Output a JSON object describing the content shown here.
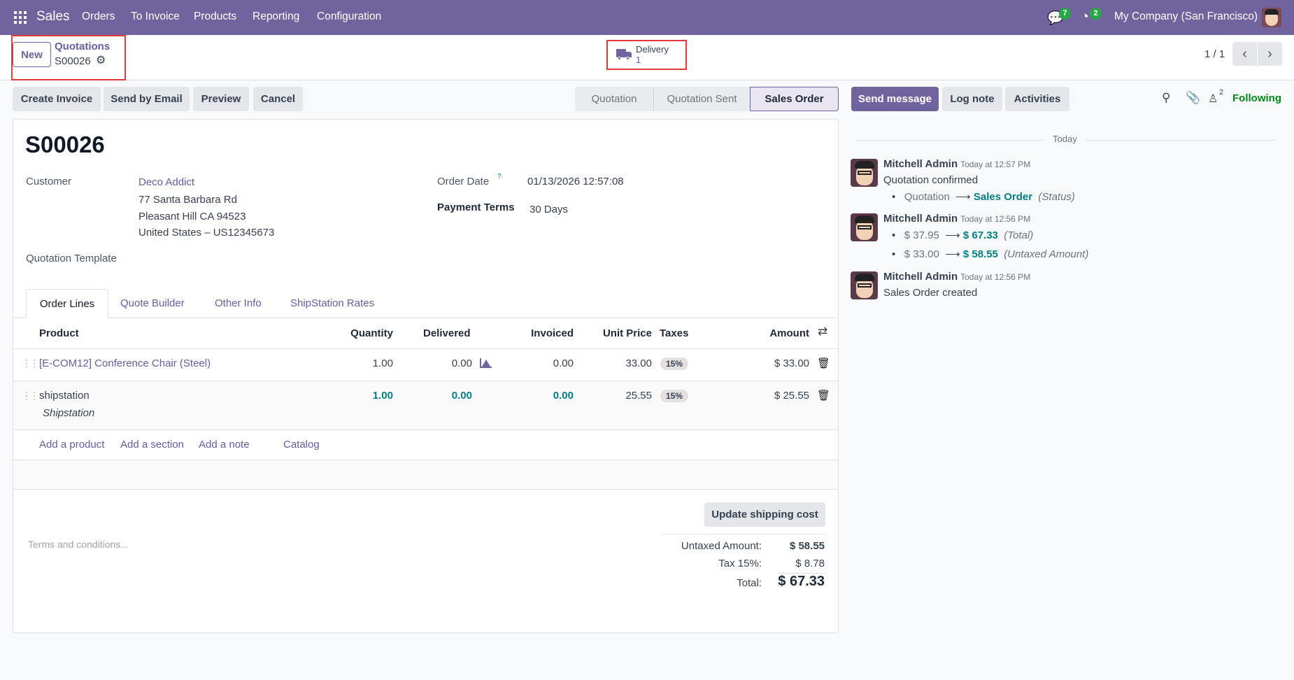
{
  "navbar": {
    "app": "Sales",
    "menu": [
      "Orders",
      "To Invoice",
      "Products",
      "Reporting",
      "Configuration"
    ],
    "messages_count": "7",
    "activities_count": "2",
    "company": "My Company (San Francisco)"
  },
  "control": {
    "new_label": "New",
    "breadcrumb_parent": "Quotations",
    "breadcrumb_current": "S00026",
    "delivery_label": "Delivery",
    "delivery_count": "1",
    "pager": "1 / 1"
  },
  "actions": {
    "create_invoice": "Create Invoice",
    "send_email": "Send by Email",
    "preview": "Preview",
    "cancel": "Cancel"
  },
  "statusbar": [
    "Quotation",
    "Quotation Sent",
    "Sales Order"
  ],
  "chatter_actions": {
    "send_message": "Send message",
    "log_note": "Log note",
    "activities": "Activities",
    "followers_count": "2",
    "following": "Following"
  },
  "form": {
    "title": "S00026",
    "customer_label": "Customer",
    "customer_name": "Deco Addict",
    "address": [
      "77 Santa Barbara Rd",
      "Pleasant Hill CA 94523",
      "United States – US12345673"
    ],
    "order_date_label": "Order Date",
    "order_date_help": "?",
    "order_date": "01/13/2026 12:57:08",
    "payment_terms_label": "Payment Terms",
    "payment_terms": "30 Days",
    "template_label": "Quotation Template"
  },
  "tabs": [
    "Order Lines",
    "Quote Builder",
    "Other Info",
    "ShipStation Rates"
  ],
  "table": {
    "headers": {
      "product": "Product",
      "quantity": "Quantity",
      "delivered": "Delivered",
      "invoiced": "Invoiced",
      "unit_price": "Unit Price",
      "taxes": "Taxes",
      "amount": "Amount"
    },
    "rows": [
      {
        "product": "[E-COM12] Conference Chair (Steel)",
        "description": "",
        "quantity": "1.00",
        "delivered": "0.00",
        "invoiced": "0.00",
        "unit_price": "33.00",
        "tax": "15%",
        "amount": "$ 33.00"
      },
      {
        "product": "shipstation",
        "description": "Shipstation",
        "quantity": "1.00",
        "delivered": "0.00",
        "invoiced": "0.00",
        "unit_price": "25.55",
        "tax": "15%",
        "amount": "$ 25.55"
      }
    ],
    "add_links": [
      "Add a product",
      "Add a section",
      "Add a note",
      "Catalog"
    ]
  },
  "footer": {
    "terms_placeholder": "Terms and conditions...",
    "update_shipping": "Update shipping cost",
    "untaxed_label": "Untaxed Amount:",
    "untaxed": "$ 58.55",
    "tax_label": "Tax 15%:",
    "tax": "$ 8.78",
    "total_label": "Total:",
    "total": "$ 67.33"
  },
  "chatter": {
    "today": "Today",
    "messages": [
      {
        "author": "Mitchell Admin",
        "time": "Today at 12:57 PM",
        "body": "Quotation confirmed",
        "changes": [
          {
            "old": "Quotation",
            "new": "Sales Order",
            "field": "(Status)"
          }
        ]
      },
      {
        "author": "Mitchell Admin",
        "time": "Today at 12:56 PM",
        "body": "",
        "changes": [
          {
            "old": "$ 37.95",
            "new": "$ 67.33",
            "field": "(Total)"
          },
          {
            "old": "$ 33.00",
            "new": "$ 58.55",
            "field": "(Untaxed Amount)"
          }
        ]
      },
      {
        "author": "Mitchell Admin",
        "time": "Today at 12:56 PM",
        "body": "Sales Order created",
        "changes": []
      }
    ]
  }
}
